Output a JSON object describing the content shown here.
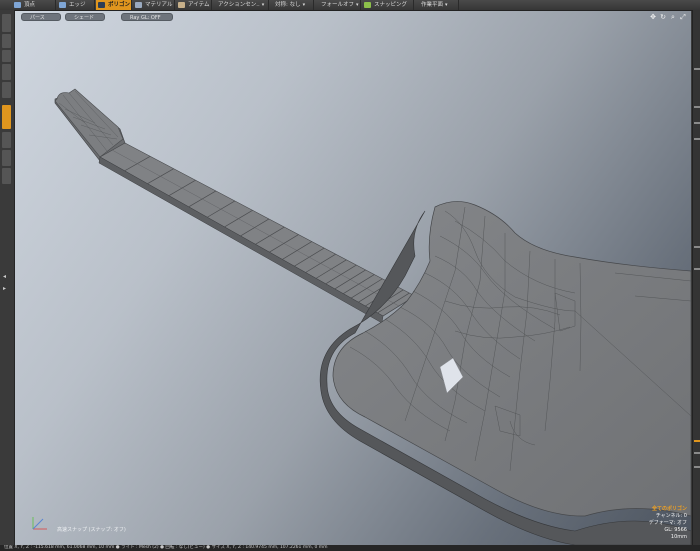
{
  "toolbar": {
    "items": [
      {
        "label": "頂点",
        "icon": "vertex-mode-icon"
      },
      {
        "label": "エッジ",
        "icon": "edge-mode-icon"
      },
      {
        "label": "ポリゴン",
        "icon": "polygon-mode-icon",
        "active": true
      },
      {
        "label": "マテリアル",
        "icon": "material-mode-icon"
      },
      {
        "label": "アイテム",
        "icon": "item-mode-icon"
      },
      {
        "label": "アクションセン..",
        "icon": "action-center-icon"
      },
      {
        "label": "対称: なし",
        "icon": ""
      },
      {
        "label": "フォールオフ",
        "icon": ""
      },
      {
        "label": "スナッピング",
        "icon": "snapping-icon"
      },
      {
        "label": "作業平面",
        "icon": ""
      }
    ],
    "accent": "#e0961e"
  },
  "viewport": {
    "tabs": [
      "パース",
      "シェード",
      "Ray GL: OFF"
    ],
    "tools": [
      "move-view-icon",
      "rotate-view-icon",
      "zoom-view-icon",
      "maximize-view-icon"
    ],
    "info_title": "全てのポリゴン",
    "info_rows": [
      "チャンネル: 0",
      "デフォーマ: オフ",
      "GL: 9566",
      "10mm"
    ],
    "snap_hint": "高速スナップ (スナップ: オフ)"
  },
  "left_dock": {
    "active_tab": "モデリング"
  },
  "statusbar": {
    "text": "位置 X, Y, Z : -115.618 mm, 61.0068 mm, 10 mm  ● ライト : Mesh (2)  ● 回転 : なし(ビュー) ● サイズ X, Y, Z : 140.9745 mm, 107.2261 mm, 0 mm"
  },
  "colors": {
    "mesh_fill": "#7a7c7f",
    "mesh_wire": "#4a4c4f",
    "selected_poly": "#dfe3ea"
  }
}
